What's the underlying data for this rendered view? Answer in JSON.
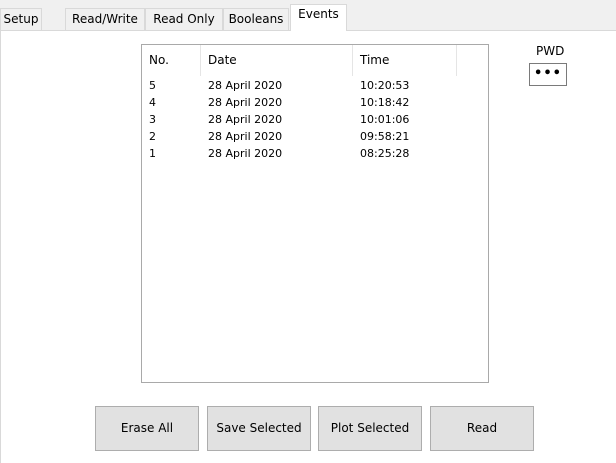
{
  "tabs": [
    {
      "label": "Setup"
    },
    {
      "label": "Read/Write"
    },
    {
      "label": "Read Only"
    },
    {
      "label": "Booleans"
    },
    {
      "label": "Events"
    }
  ],
  "active_tab": "Events",
  "events_list": {
    "columns": [
      "No.",
      "Date",
      "Time"
    ],
    "rows": [
      {
        "no": "5",
        "date": "28 April 2020",
        "time": "10:20:53"
      },
      {
        "no": "4",
        "date": "28 April 2020",
        "time": "10:18:42"
      },
      {
        "no": "3",
        "date": "28 April 2020",
        "time": "10:01:06"
      },
      {
        "no": "2",
        "date": "28 April 2020",
        "time": "09:58:21"
      },
      {
        "no": "1",
        "date": "28 April 2020",
        "time": "08:25:28"
      }
    ]
  },
  "pwd": {
    "label": "PWD",
    "value": "•••"
  },
  "buttons": {
    "erase_all": "Erase All",
    "save_selected": "Save Selected",
    "plot_selected": "Plot Selected",
    "read": "Read"
  }
}
